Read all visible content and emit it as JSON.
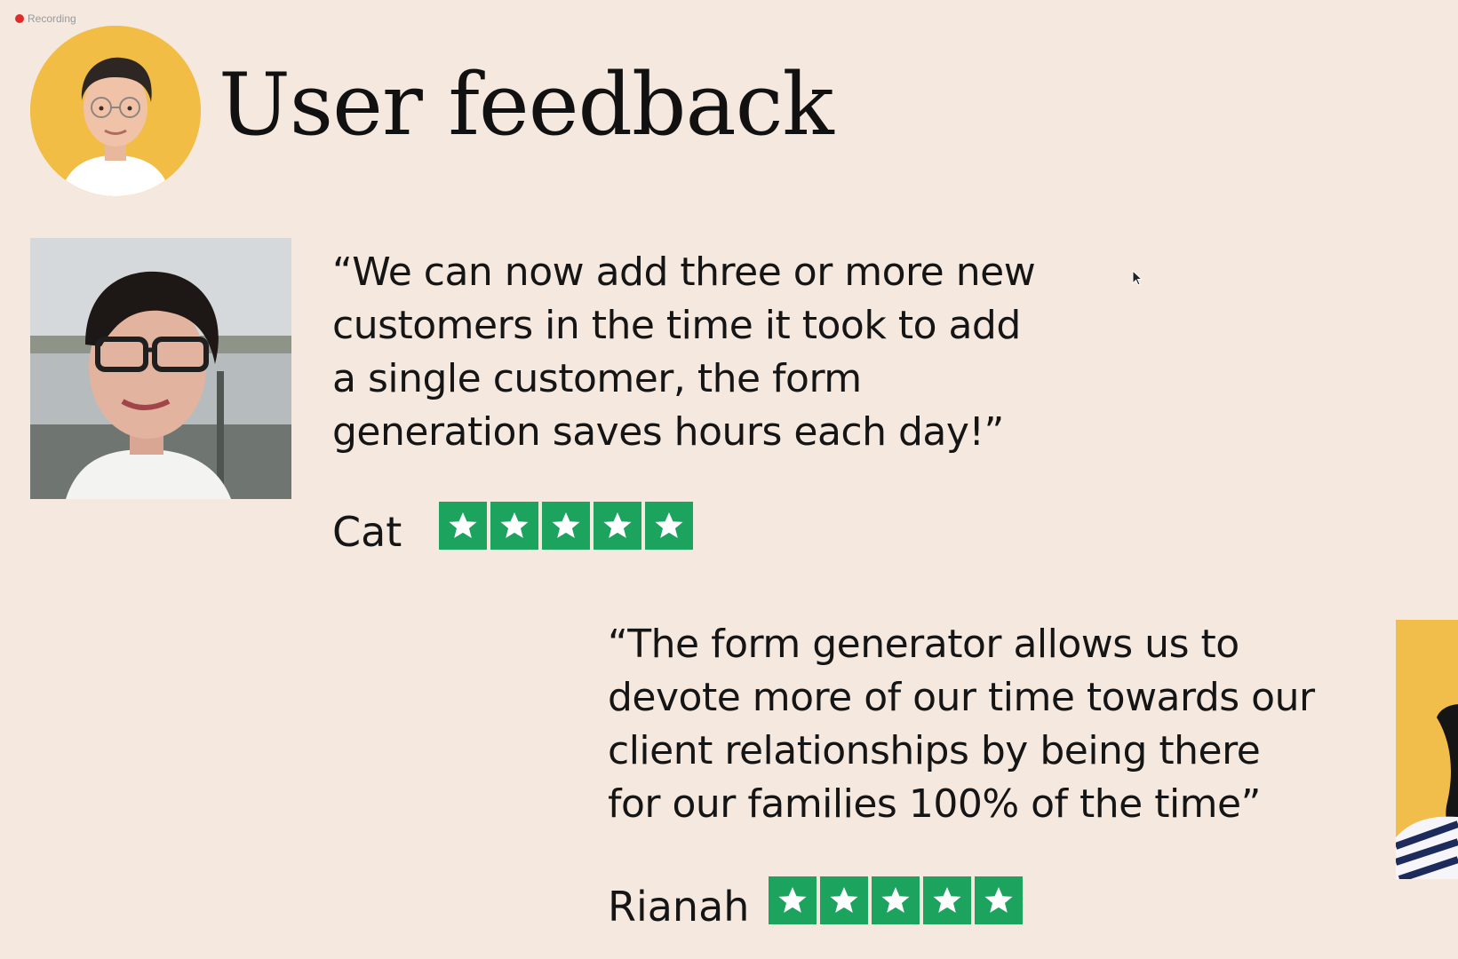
{
  "recording_indicator": {
    "label": "Recording"
  },
  "slide": {
    "title": "User feedback"
  },
  "testimonials": [
    {
      "quote": "“We can now add three or more new\ncustomers in the time it took to add\na single customer, the form\ngeneration saves hours each day!”",
      "name": "Cat",
      "rating": 5
    },
    {
      "quote": "“The form generator allows us to\ndevote more of our time towards our\nclient relationships by being there\nfor our families 100% of the time”",
      "name": "Rianah",
      "rating": 5
    }
  ],
  "colors": {
    "background": "#f4e8df",
    "star_green": "#1ca35e",
    "avatar_yellow": "#f2bd45",
    "recording_red": "#e02b2b"
  },
  "icons": {
    "star": "star-icon",
    "cursor": "mouse-pointer-icon",
    "recording": "recording-dot-icon"
  }
}
